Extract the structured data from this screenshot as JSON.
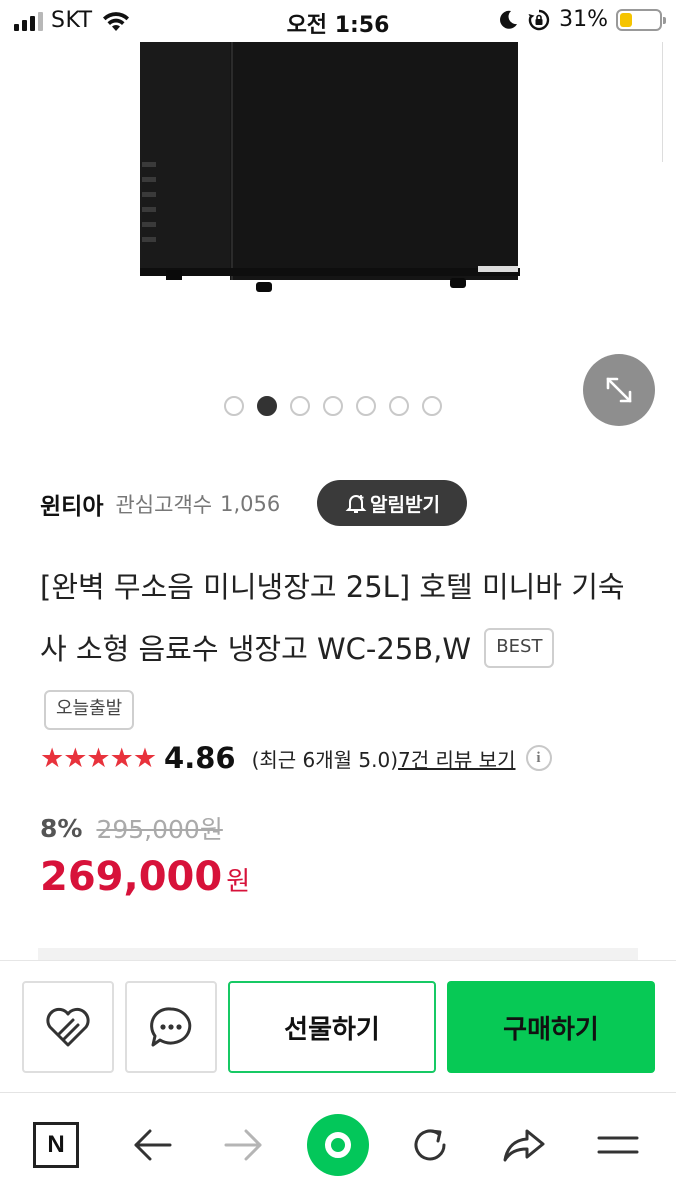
{
  "status_bar": {
    "carrier": "SKT",
    "time": "오전 1:56",
    "battery_pct": "31%",
    "battery_level": 0.31
  },
  "gallery": {
    "total_slides": 7,
    "active_index": 1
  },
  "seller": {
    "name": "윈티아",
    "interest_label": "관심고객수",
    "interest_count": "1,056",
    "notify_label": "알림받기"
  },
  "product": {
    "title": "[완벽 무소음 미니냉장고 25L] 호텔 미니바 기숙사 소형 음료수 냉장고 WC-25B,W",
    "tags": [
      "BEST",
      "오늘출발"
    ]
  },
  "rating": {
    "stars_filled": 5,
    "score": "4.86",
    "recent": "(최근 6개월 5.0)",
    "review_link": "7건 리뷰 보기",
    "info": "i"
  },
  "price": {
    "discount": "8%",
    "original": "295,000원",
    "sale": "269,000",
    "currency": "원",
    "accent_color": "#d7123a"
  },
  "actions": {
    "wishlist_icon": "heart-icon",
    "talk_icon": "chat-bubble-icon",
    "gift_label": "선물하기",
    "buy_label": "구매하기",
    "buy_color": "#07c955"
  },
  "browser_nav": {
    "home_label": "N",
    "items": [
      "naver-home",
      "back",
      "forward",
      "green-dot",
      "reload",
      "share",
      "menu"
    ]
  }
}
